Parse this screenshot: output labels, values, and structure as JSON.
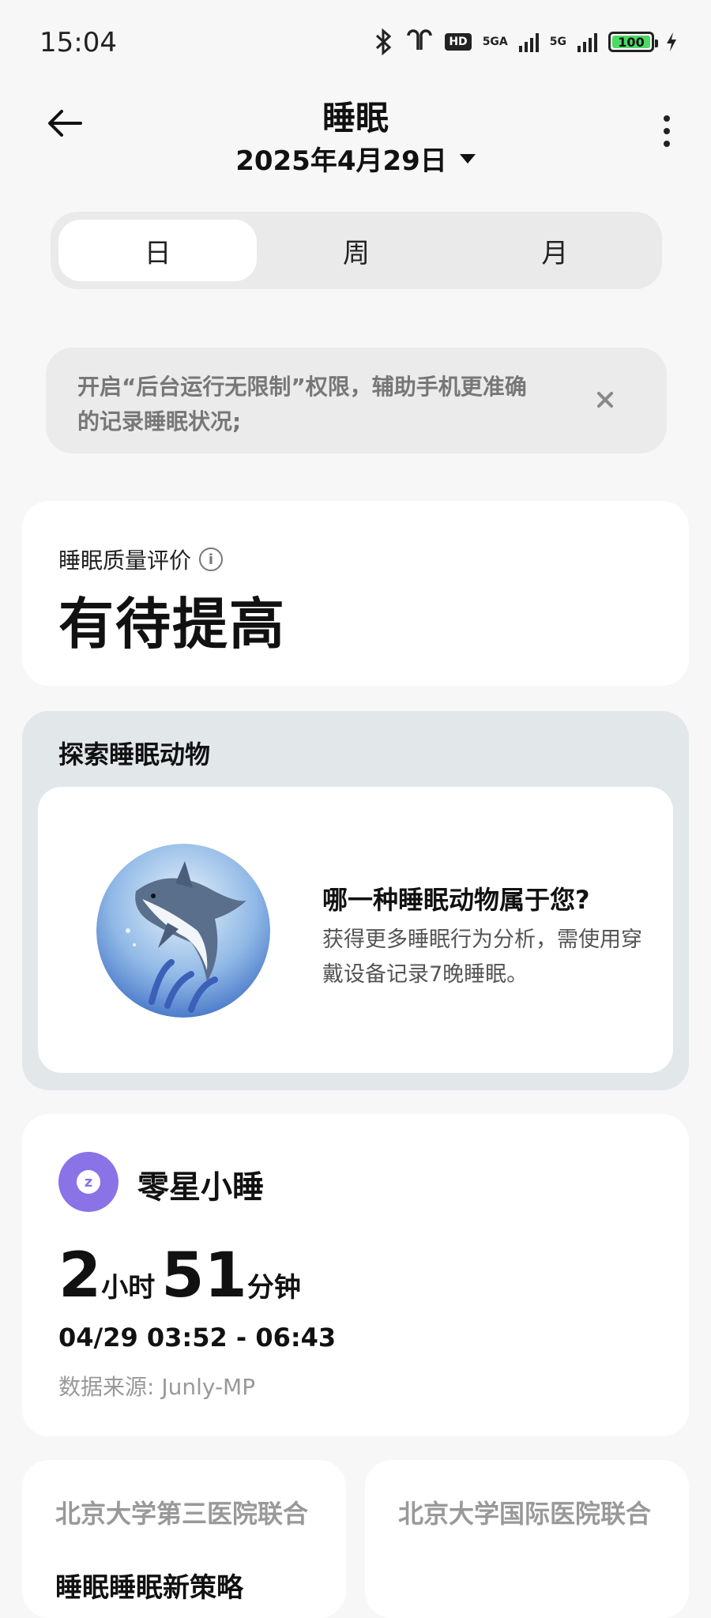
{
  "status_bar": {
    "time": "15:04",
    "network_1": "5GA",
    "network_2": "5G",
    "hd_badge": "HD",
    "battery": "100",
    "icons": [
      "bluetooth-icon",
      "earbuds-icon",
      "signal-icon",
      "battery-icon",
      "charging-icon"
    ]
  },
  "header": {
    "title": "睡眠",
    "date": "2025年4月29日"
  },
  "tabs": [
    {
      "label": "日",
      "active": true
    },
    {
      "label": "周",
      "active": false
    },
    {
      "label": "月",
      "active": false
    }
  ],
  "notice": {
    "text": "开启“后台运行无限制”权限，辅助手机更准确的记录睡眠状况;"
  },
  "quality": {
    "label": "睡眠质量评价",
    "value": "有待提高"
  },
  "animal": {
    "heading": "探索睡眠动物",
    "question": "哪一种睡眠动物属于您?",
    "description": "获得更多睡眠行为分析，需使用穿戴设备记录7晚睡眠。"
  },
  "nap": {
    "title": "零星小睡",
    "hours": "2",
    "hours_unit": "小时",
    "minutes": "51",
    "minutes_unit": "分钟",
    "time_range": "04/29 03:52 - 06:43",
    "source": "数据来源: Junly-MP"
  },
  "hospitals": [
    {
      "name": "北京大学第三医院联合",
      "cut_text": "睡眠睡眠新策略"
    },
    {
      "name": "北京大学国际医院联合",
      "cut_text": ""
    }
  ],
  "colors": {
    "accent_purple": "#8a73e6",
    "background": "#f7f7f7",
    "card": "#ffffff"
  }
}
